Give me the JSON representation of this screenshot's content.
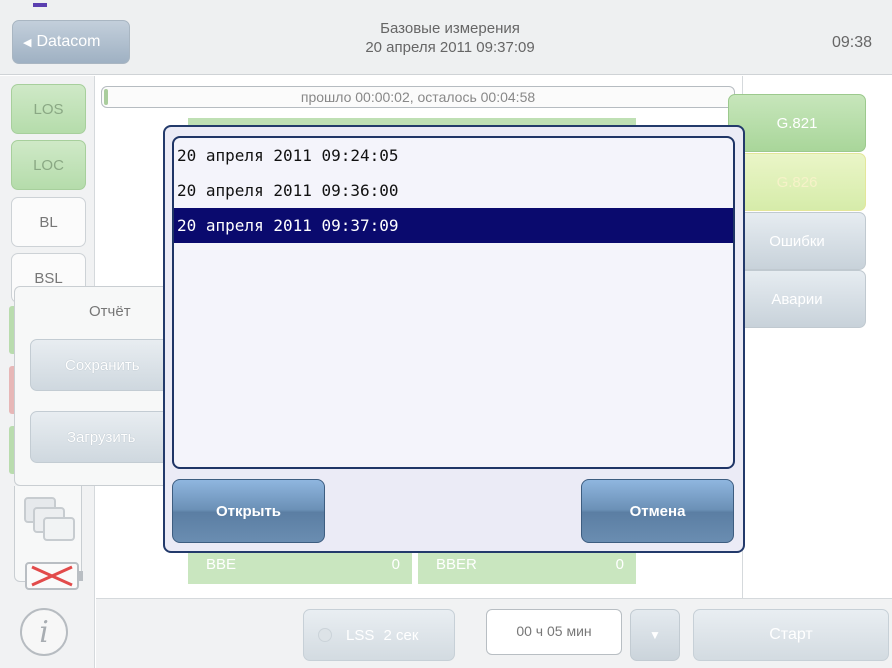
{
  "header": {
    "back_label": "Datacom",
    "title": "Базовые измерения",
    "subtitle": "20 апреля 2011 09:37:09",
    "time": "09:38"
  },
  "left_nav": {
    "items": [
      "LOS",
      "LOC",
      "BL",
      "BSL"
    ]
  },
  "progress": {
    "text": "прошло 00:00:02, осталось 00:04:58",
    "fraction": 0.007
  },
  "right_tabs": [
    "G.821",
    "G.826",
    "Ошибки",
    "Аварии"
  ],
  "report_panel": {
    "title": "Отчёт",
    "save_label": "Сохранить",
    "load_label": "Загрузить"
  },
  "results": {
    "bbe_label": "BBE",
    "bbe_value": "0",
    "bber_label": "BBER",
    "bber_value": "0"
  },
  "bottom": {
    "lss_label": "LSS",
    "lss_value": "2 сек",
    "duration": "00 ч 05 мин",
    "dropdown_symbol": "▼",
    "start_label": "Старт"
  },
  "dialog": {
    "items": [
      "20 апреля 2011 09:24:05",
      "20 апреля 2011 09:36:00",
      "20 апреля 2011 09:37:09"
    ],
    "selected_index": 2,
    "open_label": "Открыть",
    "cancel_label": "Отмена"
  },
  "icons": {
    "back": "back-arrow-icon",
    "info": "info-icon",
    "folder": "folder-icon",
    "battery": "battery-empty-icon"
  },
  "colors": {
    "selection": "#0a0a6e",
    "dialog_border": "#233a6b",
    "green_tab": "#b5dcab",
    "button_blue": "#6b90b6"
  }
}
